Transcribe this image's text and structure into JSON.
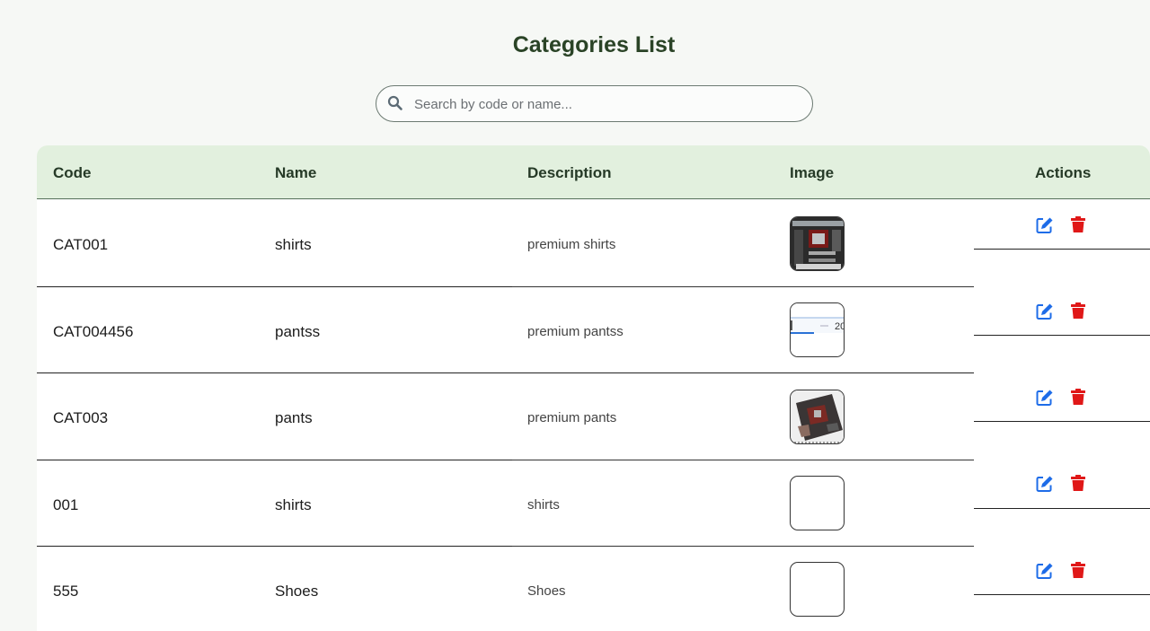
{
  "page": {
    "title": "Categories List"
  },
  "search": {
    "placeholder": "Search by code or name..."
  },
  "table": {
    "headers": {
      "code": "Code",
      "name": "Name",
      "description": "Description",
      "image": "Image",
      "actions": "Actions"
    },
    "rows": [
      {
        "code": "CAT001",
        "name": "shirts",
        "description": "premium shirts",
        "image": "motherboard-photo"
      },
      {
        "code": "CAT004456",
        "name": "pantss",
        "description": "premium pantss",
        "image": "screenshot-thumbnail"
      },
      {
        "code": "CAT003",
        "name": "pants",
        "description": "premium pants",
        "image": "circuit-board-photo"
      },
      {
        "code": "001",
        "name": "shirts",
        "description": "shirts",
        "image": "empty"
      },
      {
        "code": "555",
        "name": "Shoes",
        "description": "Shoes",
        "image": "empty"
      }
    ]
  },
  "colors": {
    "edit": "#1e6ce8",
    "delete": "#e01818",
    "header_bg": "#e2f0de",
    "title": "#2a4326"
  }
}
